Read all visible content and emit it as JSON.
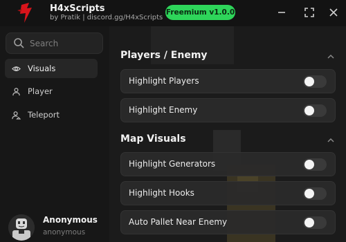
{
  "header": {
    "title": "H4xScripts",
    "subtitle": "by Pratik | discord.gg/H4xScripts",
    "version_badge": "Freemium v1.0.0",
    "accent_color": "#2ed55a",
    "logo_color": "#d8141b"
  },
  "window_controls": [
    "minimize-icon",
    "maximize-icon",
    "close-icon"
  ],
  "search": {
    "placeholder": "Search"
  },
  "sidebar": {
    "items": [
      {
        "label": "Visuals",
        "icon": "eye-icon",
        "active": true
      },
      {
        "label": "Player",
        "icon": "user-icon",
        "active": false
      },
      {
        "label": "Teleport",
        "icon": "user-pin-icon",
        "active": false
      }
    ]
  },
  "profile": {
    "name": "Anonymous",
    "handle": "anonymous"
  },
  "sections": [
    {
      "title": "Players / Enemy",
      "items": [
        {
          "label": "Highlight Players",
          "enabled": false
        },
        {
          "label": "Highlight Enemy",
          "enabled": false
        }
      ]
    },
    {
      "title": "Map Visuals",
      "items": [
        {
          "label": "Highlight Generators",
          "enabled": false
        },
        {
          "label": "Highlight Hooks",
          "enabled": false
        },
        {
          "label": "Auto Pallet Near Enemy",
          "enabled": false
        }
      ]
    }
  ]
}
